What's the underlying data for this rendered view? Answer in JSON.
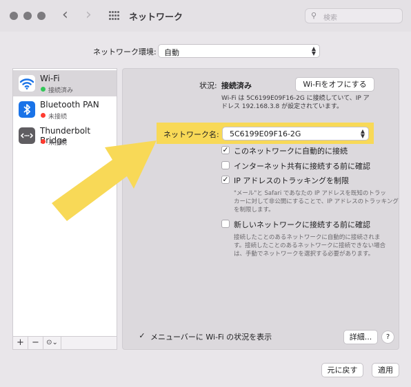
{
  "window": {
    "title": "ネットワーク"
  },
  "search": {
    "placeholder": "検索"
  },
  "location": {
    "label": "ネットワーク環境:",
    "value": "自動"
  },
  "sidebar": {
    "items": [
      {
        "name": "Wi-Fi",
        "status": "接続済み",
        "status_color": "#34c759",
        "icon": "wifi-icon"
      },
      {
        "name": "Bluetooth PAN",
        "status": "未接続",
        "status_color": "#ff3b30",
        "icon": "bluetooth-icon"
      },
      {
        "name": "Thunderbolt Bridge",
        "status": "未接続",
        "status_color": "#ff3b30",
        "icon": "thunderbolt-bridge-icon"
      }
    ],
    "add": "+",
    "remove": "−",
    "action": "⊙⌄"
  },
  "detail": {
    "status_label": "状況:",
    "status_value": "接続済み",
    "wifi_off_button": "Wi-Fiをオフにする",
    "status_desc_line1": "Wi-Fi は 5C6199E09F16-2G に接続していて、IP ア",
    "status_desc_line2": "ドレス 192.168.3.8 が設定されています。",
    "network_name_label": "ネットワーク名:",
    "network_name_value": "5C6199E09F16-2G",
    "options": [
      {
        "label": "このネットワークに自動的に接続",
        "checked": true
      },
      {
        "label": "インターネット共有に接続する前に確認",
        "checked": false
      },
      {
        "label": "IP アドレスのトラッキングを制限",
        "checked": true
      },
      {
        "label": "新しいネットワークに接続する前に確認",
        "checked": false
      }
    ],
    "tracking_desc_line1": "\"メール\"と Safari であなたの IP アドレスを既知のトラッ",
    "tracking_desc_line2": "カーに対して非公開にすることで、IP アドレスのトラッキング",
    "tracking_desc_line3": "を制限します。",
    "ask_desc_line1": "接続したことのあるネットワークに自動的に接続されま",
    "ask_desc_line2": "す。接続したことのあるネットワークに接続できない場合",
    "ask_desc_line3": "は、手動でネットワークを選択する必要があります。",
    "menubar_label": "メニューバーに Wi-Fi の状況を表示",
    "menubar_checked": true,
    "advanced_button": "詳細...",
    "help_button": "?"
  },
  "footer": {
    "revert_button": "元に戻す",
    "apply_button": "適用"
  },
  "colors": {
    "highlight": "#f8d957",
    "arrow": "#f8d957"
  }
}
